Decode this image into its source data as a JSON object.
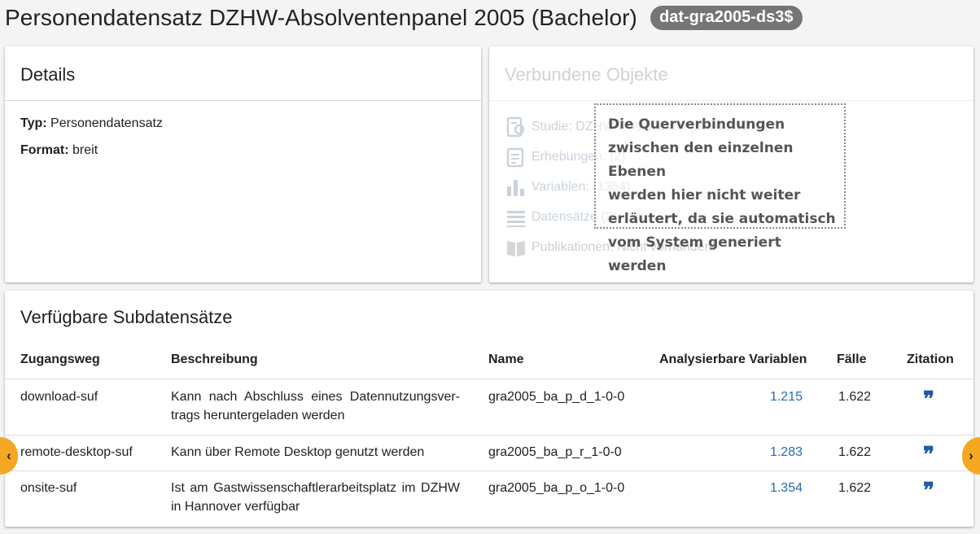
{
  "header": {
    "title": "Personendatensatz DZHW-Absolventenpanel 2005 (Bachelor)",
    "id_badge": "dat-gra2005-ds3$"
  },
  "details": {
    "title": "Details",
    "type_label": "Typ:",
    "type_value": "Personendatensatz",
    "format_label": "Format:",
    "format_value": "breit"
  },
  "linked": {
    "title": "Verbundene Objekte",
    "items": [
      {
        "label": "Studie: DZHW-Absolventenpanel 2005",
        "icon": "study-icon"
      },
      {
        "label": "Erhebungen: (2)",
        "icon": "survey-icon"
      },
      {
        "label": "Variablen: (1354)",
        "icon": "bar-chart-icon"
      },
      {
        "label": "Datensätze (2)",
        "icon": "table-list-icon"
      },
      {
        "label": "Publikationen: Nicht vorhanden!",
        "icon": "book-icon"
      }
    ]
  },
  "annotation": {
    "lines": [
      "Die Querverbindungen",
      "zwischen den einzelnen Ebenen",
      "werden hier nicht weiter",
      "erläutert, da sie automatisch",
      "vom System generiert werden"
    ]
  },
  "subdata": {
    "title": "Verfügbare Subdatensätze",
    "columns": {
      "access": "Zugangsweg",
      "description": "Beschreibung",
      "name": "Name",
      "variables": "Analysierbare Variablen",
      "cases": "Fälle",
      "citation": "Zitation"
    },
    "rows": [
      {
        "access": "download-suf",
        "description": "Kann nach Abschluss eines Datennutzungsver-trags heruntergeladen werden",
        "name": "gra2005_ba_p_d_1-0-0",
        "variables": "1.215",
        "cases": "1.622"
      },
      {
        "access": "remote-desktop-suf",
        "description": "Kann über Remote Desktop genutzt werden",
        "name": "gra2005_ba_p_r_1-0-0",
        "variables": "1.283",
        "cases": "1.622"
      },
      {
        "access": "onsite-suf",
        "description": "Ist am Gastwissenschaftlerarbeitsplatz im DZHW in Hannover verfügbar",
        "name": "gra2005_ba_p_o_1-0-0",
        "variables": "1.354",
        "cases": "1.622"
      }
    ],
    "citation_glyph": "❞"
  },
  "nav": {
    "prev_glyph": "‹",
    "next_glyph": "›"
  },
  "colors": {
    "link": "#2a6bb0",
    "accent_orange": "#f5a623",
    "badge": "#757575",
    "quote": "#1f5aa6"
  }
}
